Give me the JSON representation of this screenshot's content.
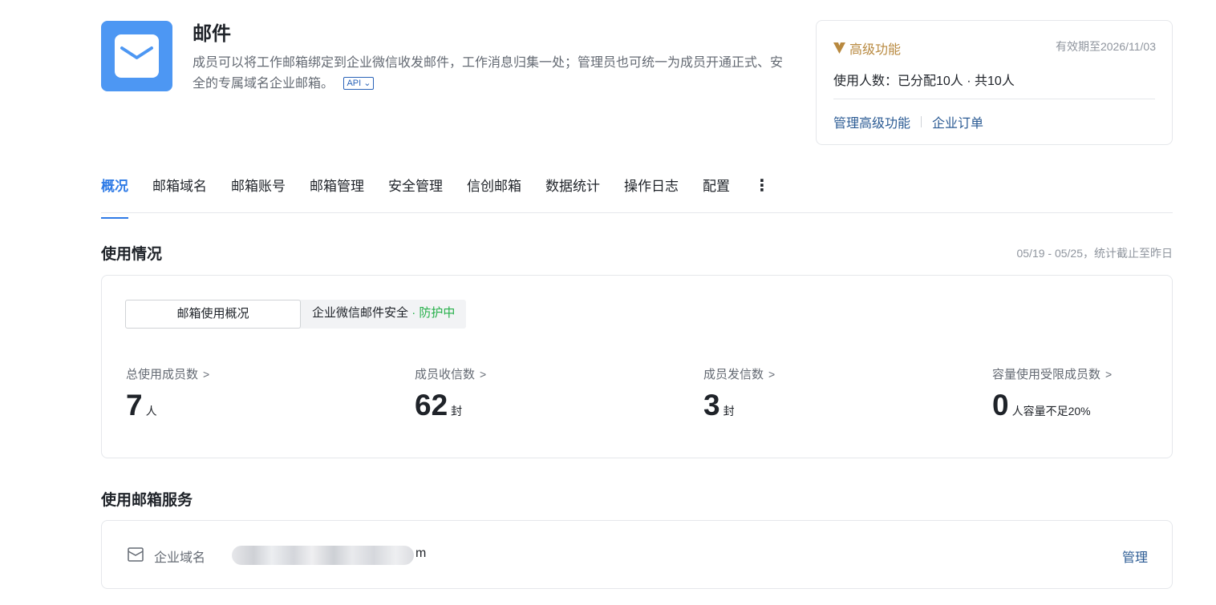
{
  "app": {
    "title": "邮件",
    "description": "成员可以将工作邮箱绑定到企业微信收发邮件，工作消息归集一处；管理员也可统一为成员开通正式、安全的专属域名企业邮箱。",
    "api_badge": "API",
    "icon": "mail-icon",
    "icon_color": "#4d97f3"
  },
  "premium": {
    "title": "高级功能",
    "expiry": "有效期至2026/11/03",
    "usage": "使用人数：已分配10人 · 共10人",
    "links": [
      "管理高级功能",
      "企业订单"
    ],
    "accent_color": "#b8893f"
  },
  "tabs": [
    {
      "label": "概况",
      "active": true
    },
    {
      "label": "邮箱域名",
      "active": false
    },
    {
      "label": "邮箱账号",
      "active": false
    },
    {
      "label": "邮箱管理",
      "active": false
    },
    {
      "label": "安全管理",
      "active": false
    },
    {
      "label": "信创邮箱",
      "active": false
    },
    {
      "label": "数据统计",
      "active": false
    },
    {
      "label": "操作日志",
      "active": false
    },
    {
      "label": "配置",
      "active": false
    }
  ],
  "usage": {
    "title": "使用情况",
    "note": "05/19 - 05/25，统计截止至昨日",
    "segments": {
      "overview": "邮箱使用概况",
      "security": "企业微信邮件安全",
      "security_status": "· 防护中"
    },
    "stats": [
      {
        "label": "总使用成员数",
        "value": "7",
        "unit": "人"
      },
      {
        "label": "成员收信数",
        "value": "62",
        "unit": "封"
      },
      {
        "label": "成员发信数",
        "value": "3",
        "unit": "封"
      },
      {
        "label": "容量使用受限成员数",
        "value": "0",
        "unit": "人容量不足20%"
      }
    ]
  },
  "service": {
    "title": "使用邮箱服务",
    "label": "企业域名",
    "domain_visible_tail": "m",
    "manage": "管理"
  },
  "colors": {
    "accent": "#2f7be6",
    "link": "#2a5a93",
    "status_ok": "#27b04b"
  }
}
